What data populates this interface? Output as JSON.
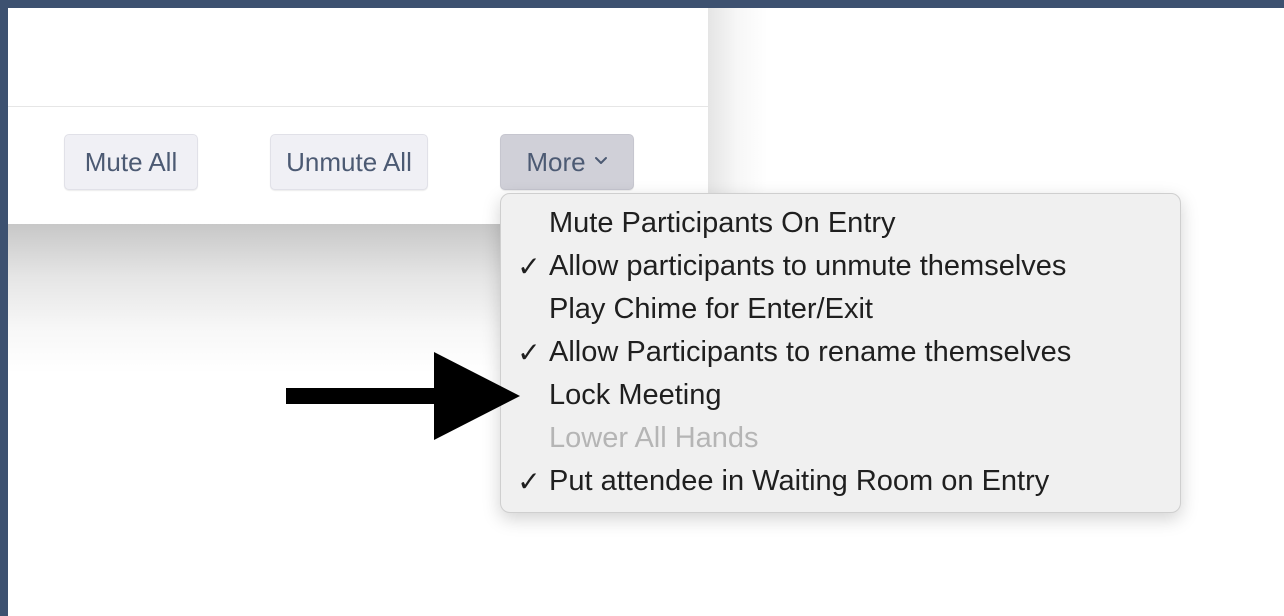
{
  "buttons": {
    "mute_all": "Mute All",
    "unmute_all": "Unmute All",
    "more": "More",
    "more_icon": "chevron-down-icon"
  },
  "menu": {
    "items": [
      {
        "label": "Mute Participants On Entry",
        "checked": false,
        "enabled": true
      },
      {
        "label": "Allow participants to unmute themselves",
        "checked": true,
        "enabled": true
      },
      {
        "label": "Play Chime for Enter/Exit",
        "checked": false,
        "enabled": true
      },
      {
        "label": "Allow Participants to rename themselves",
        "checked": true,
        "enabled": true
      },
      {
        "label": "Lock Meeting",
        "checked": false,
        "enabled": true
      },
      {
        "label": "Lower All Hands",
        "checked": false,
        "enabled": false
      },
      {
        "label": "Put attendee in Waiting Room on Entry",
        "checked": true,
        "enabled": true
      }
    ],
    "check_glyph": "✓"
  },
  "annotation": {
    "icon": "arrow-right-icon",
    "color": "#000000"
  },
  "colors": {
    "frame": "#3d5170",
    "button_text": "#4c5a73",
    "menu_bg": "#f0f0f0",
    "disabled_text": "#b5b5b5"
  }
}
